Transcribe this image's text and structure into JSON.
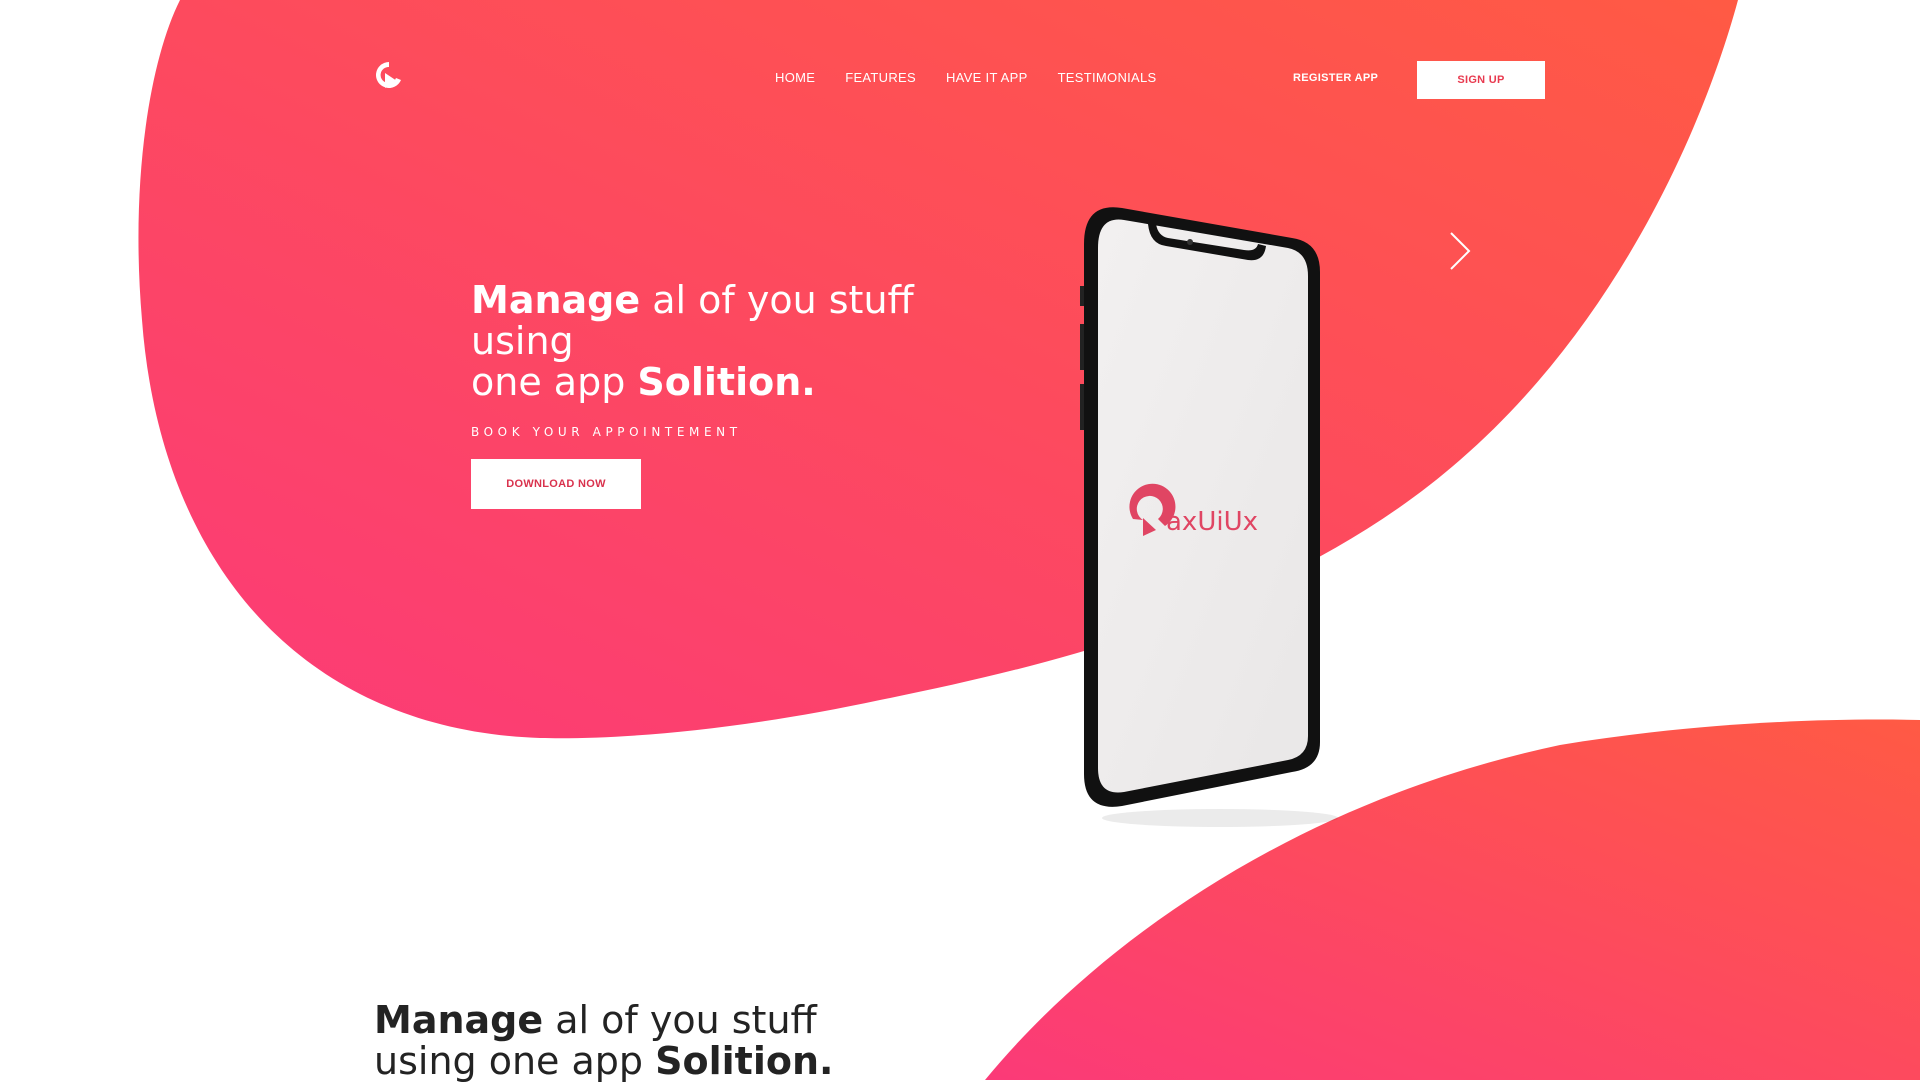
{
  "brand": {
    "name": "axUiUx",
    "colors": {
      "pink": "#fb3a78",
      "coral": "#ff5a44",
      "white": "#ffffff"
    }
  },
  "nav": {
    "items": [
      {
        "label": "HOME"
      },
      {
        "label": "FEATURES"
      },
      {
        "label": "HAVE IT APP"
      },
      {
        "label": "TESTIMONIALS"
      }
    ],
    "register_label": "REGISTER APP",
    "signup_label": "SIGN UP"
  },
  "hero": {
    "title_bold_1": "Manage",
    "title_rest_1": " al of you stuff using",
    "title_rest_2": "one app ",
    "title_bold_2": "Solition.",
    "subtitle": "BOOK YOUR APPOINTEMENT",
    "cta_label": "DOWNLOAD NOW"
  },
  "section2": {
    "title_bold_1": "Manage",
    "title_rest_1": " al of you stuff",
    "title_rest_2": "using one app ",
    "title_bold_2": "Solition."
  }
}
